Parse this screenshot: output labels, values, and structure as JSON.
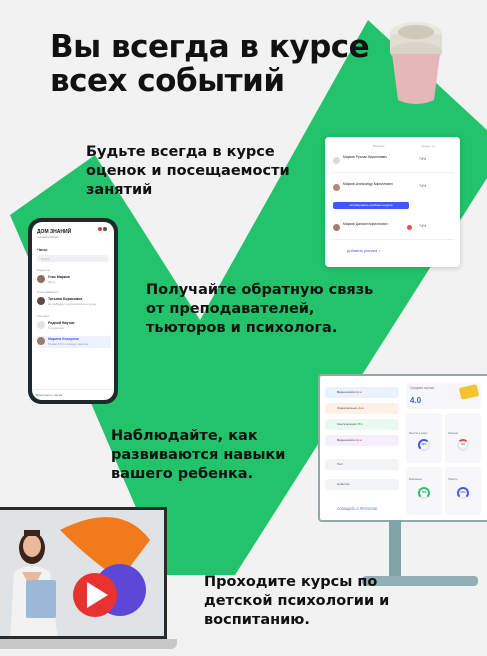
{
  "title": "Вы всегда в курсе всех событий",
  "captions": {
    "grades": "Будьте всегда в курсе оценок и посещаемости занятий",
    "feedback": "Получайте обратную связь от преподавателей, тьюторов и психолога.",
    "skills": "Наблюдайте, как развиваются навыки вашего ребенка.",
    "courses": "Проходите курсы по детской психологии и воспитанию."
  },
  "colors": {
    "checkmark": "#25c46a",
    "accent_blue": "#3d5af1",
    "accent_orange": "#f07a1c",
    "play_red": "#e8322f"
  },
  "phone": {
    "app_title": "ДОМ ЗНАНИЙ",
    "app_subtitle": "личный кабинет",
    "chats_label": "Чаты",
    "search_placeholder": "Поиск",
    "sections": [
      "Родитель",
      "Преподаватели",
      "Тьюторы"
    ],
    "items": [
      {
        "name": "Утас Марков",
        "msg": "Фото"
      },
      {
        "name": "Татьяна Борисовна",
        "msg": "Не забудьте подготовиться к уроку"
      },
      {
        "name": "Родной Наутов",
        "msg": "1 прочитал"
      },
      {
        "name": "Марина Кокорина",
        "msg": "Привет! Я по поводу занятия"
      }
    ],
    "bottom_label": "Вернуться к Чатам"
  },
  "grades_card": {
    "col_student": "Ребенок",
    "col_avg": "Средн. уч.",
    "rows": [
      {
        "name": "Марков Руслан Кириллович",
        "pct": "74%"
      },
      {
        "name": "Марков Александр Кириллович",
        "pct": "74%"
      },
      {
        "name": "Марков Даниил Кириллович",
        "pct": "74%"
      }
    ],
    "activate_button": "Активировать пробные недели",
    "add_student": "Добавить ученика +"
  },
  "monitor": {
    "menu": [
      {
        "label": "Видеозаписи",
        "tag": "Дом"
      },
      {
        "label": "Оздоровление",
        "tag": "Дом"
      },
      {
        "label": "Консультация",
        "tag": "95%"
      },
      {
        "label": "Видеозаписи",
        "tag": "Дом"
      },
      {
        "label": "Тест",
        "tag": ""
      },
      {
        "label": "События",
        "tag": ""
      }
    ],
    "link": "СООБЩИТЬ О ПРОПУСКЕ",
    "avg_label": "Средняя оценка",
    "avg_value": "4.0",
    "skills": [
      {
        "label": "Мысли в мире",
        "value": "64%"
      },
      {
        "label": "Эмоции",
        "value": "6%"
      },
      {
        "label": "Внимание",
        "value": "70%"
      },
      {
        "label": "Память",
        "value": "69%"
      }
    ]
  }
}
